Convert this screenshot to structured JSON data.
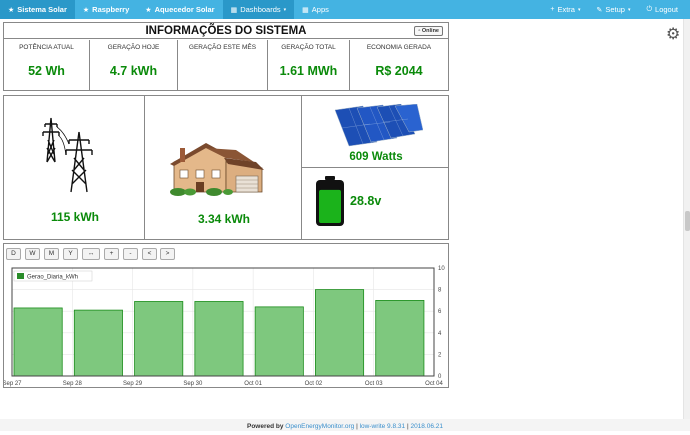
{
  "nav": {
    "left": [
      {
        "label": "Sistema Solar",
        "icon": "★"
      },
      {
        "label": "Raspberry",
        "icon": "★"
      },
      {
        "label": "Aquecedor Solar",
        "icon": "★"
      },
      {
        "label": "Dashboards",
        "icon": "▦"
      },
      {
        "label": "Apps",
        "icon": "▦"
      }
    ],
    "right": [
      {
        "label": "Extra",
        "icon": "+"
      },
      {
        "label": "Setup",
        "icon": "✎"
      },
      {
        "label": "Logout",
        "icon": "⏻"
      }
    ]
  },
  "info": {
    "title": "INFORMAÇÕES DO SISTEMA",
    "online": "Online",
    "cells": [
      {
        "label": "POTÊNCIA ATUAL",
        "value": "52 Wh"
      },
      {
        "label": "GERAÇÃO HOJE",
        "value": "4.7 kWh"
      },
      {
        "label": "GERAÇÃO ESTE MÊS",
        "value": ""
      },
      {
        "label": "GERAÇÃO TOTAL",
        "value": "1.61 MWh"
      },
      {
        "label": "ECONOMIA GERADA",
        "value": "R$ 2044"
      }
    ]
  },
  "grid": {
    "value": "115 kWh"
  },
  "house": {
    "value": "3.34 kWh"
  },
  "solar": {
    "value": "609  Watts"
  },
  "battery": {
    "value": "28.8v",
    "level": 0.85
  },
  "chart_buttons": [
    "D",
    "W",
    "M",
    "Y",
    "↔",
    "+",
    "-",
    "<",
    ">"
  ],
  "chart_data": {
    "type": "bar",
    "series": [
      {
        "name": "Gerao_Diaria_kWh",
        "values": [
          6.3,
          6.1,
          6.9,
          6.9,
          6.4,
          8.0,
          7.0
        ]
      }
    ],
    "x_ticks": [
      "Sep 27",
      "Sep 28",
      "Sep 29",
      "Sep 30",
      "Oct 01",
      "Oct 02",
      "Oct 03",
      "Oct 04"
    ],
    "y_ticks": [
      "0",
      "2",
      "4",
      "6",
      "8",
      "10"
    ],
    "ylim": [
      0,
      10
    ],
    "grid": true,
    "legend": "top-left",
    "colors": {
      "fill": "#7ec87e",
      "stroke": "#1a8c1a"
    }
  },
  "footer": {
    "prefix": "Powered by ",
    "link": "OpenEnergyMonitor.org",
    "sep1": " | ",
    "version": "low-write 9.8.31",
    "sep2": " | ",
    "date": "2018.06.21"
  }
}
